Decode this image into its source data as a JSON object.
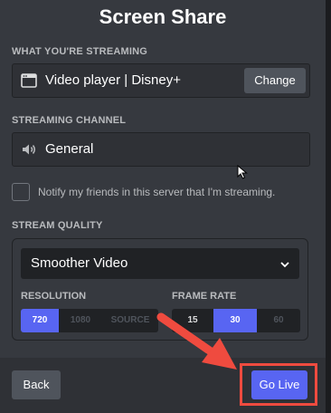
{
  "dialog": {
    "title": "Screen Share"
  },
  "streaming": {
    "section_label": "WHAT YOU'RE STREAMING",
    "source_label": "Video player | Disney+",
    "change_label": "Change"
  },
  "channel": {
    "section_label": "STREAMING CHANNEL",
    "name": "General"
  },
  "notify": {
    "label": "Notify my friends in this server that I'm streaming.",
    "checked": false
  },
  "quality": {
    "section_label": "STREAM QUALITY",
    "preset": "Smoother Video",
    "resolution": {
      "label": "RESOLUTION",
      "options": [
        "720",
        "1080",
        "SOURCE"
      ],
      "selected": "720"
    },
    "frame_rate": {
      "label": "FRAME RATE",
      "options": [
        "15",
        "30",
        "60"
      ],
      "selected": "30"
    }
  },
  "footer": {
    "back_label": "Back",
    "go_live_label": "Go Live"
  },
  "colors": {
    "accent": "#5865f2",
    "annotation": "#ef4b3f"
  }
}
